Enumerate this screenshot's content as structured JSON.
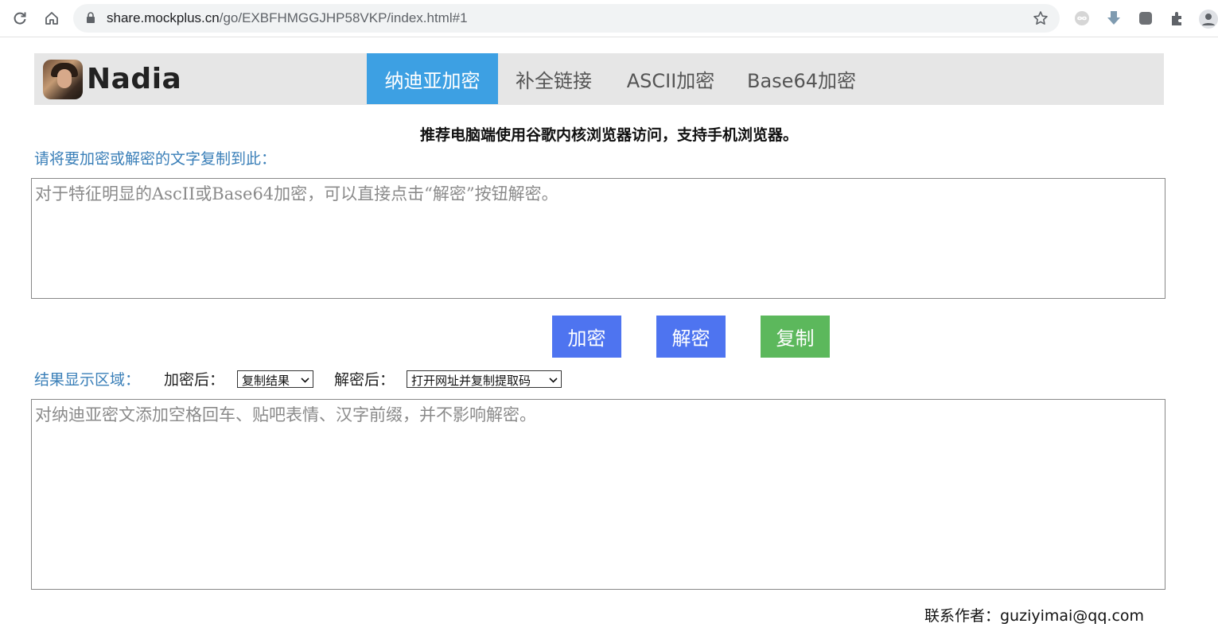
{
  "browser": {
    "url_host": "share.mockplus.cn",
    "url_path": "/go/EXBFHMGGJHP58VKP/index.html#1"
  },
  "site": {
    "brand": "Nadia",
    "tabs": [
      "纳迪亚加密",
      "补全链接",
      "ASCII加密",
      "Base64加密"
    ],
    "active_tab": "纳迪亚加密"
  },
  "notice": "推荐电脑端使用谷歌内核浏览器访问，支持手机浏览器。",
  "input": {
    "label": "请将要加密或解密的文字复制到此：",
    "placeholder": "对于特征明显的AscII或Base64加密，可以直接点击“解密”按钮解密。"
  },
  "buttons": {
    "encrypt": "加密",
    "decrypt": "解密",
    "copy": "复制"
  },
  "result": {
    "label": "结果显示区域：",
    "after_encrypt_label": "加密后：",
    "after_encrypt_value": "复制结果",
    "after_decrypt_label": "解密后：",
    "after_decrypt_value": "打开网址并复制提取码",
    "placeholder": "对纳迪亚密文添加空格回车、贴吧表情、汉字前缀，并不影响解密。"
  },
  "contact": "联系作者：guziyimai@qq.com",
  "colors": {
    "tab_active": "#3da0e3",
    "btn_primary": "#4e74f0",
    "btn_success": "#5cb85c",
    "label_blue": "#3a7fb8",
    "header_bg": "#e6e6e6"
  }
}
